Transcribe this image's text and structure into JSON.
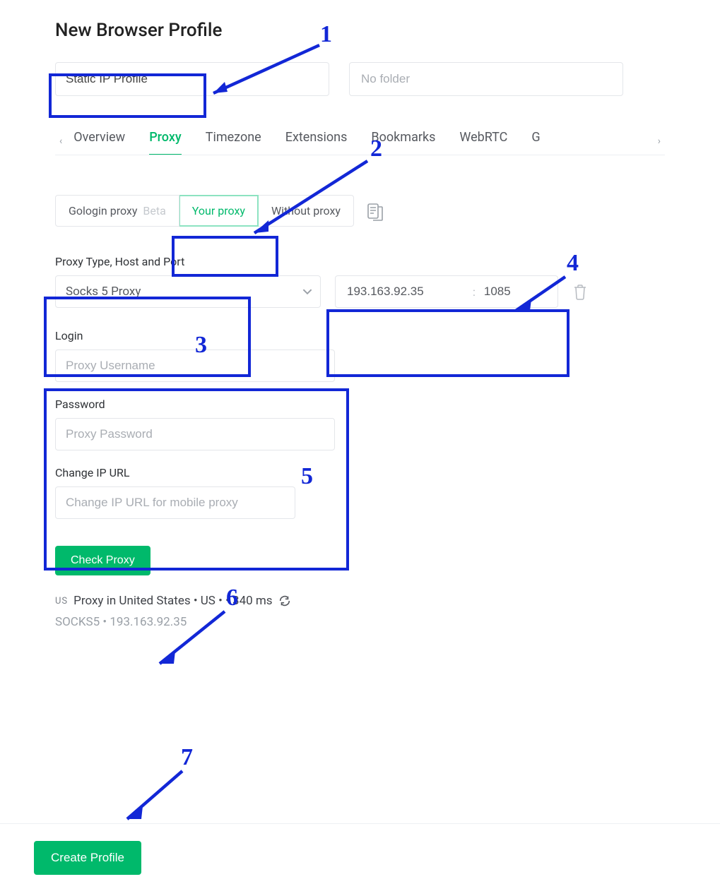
{
  "page": {
    "title": "New Browser Profile"
  },
  "profile": {
    "name": "Static IP Profile",
    "folder_placeholder": "No folder",
    "folder_value": ""
  },
  "tabs": {
    "items": [
      "Overview",
      "Proxy",
      "Timezone",
      "Extensions",
      "Bookmarks",
      "WebRTC",
      "G"
    ],
    "active_index": 1
  },
  "proxy_mode": {
    "options": [
      {
        "label": "Gologin proxy",
        "badge": "Beta"
      },
      {
        "label": "Your proxy"
      },
      {
        "label": "Without proxy"
      }
    ],
    "active_index": 1
  },
  "proxy": {
    "section_label": "Proxy Type, Host and Port",
    "type": "Socks 5 Proxy",
    "host": "193.163.92.35",
    "port": "1085",
    "login_label": "Login",
    "login_placeholder": "Proxy Username",
    "login_value": "",
    "password_label": "Password",
    "password_placeholder": "Proxy Password",
    "password_value": "",
    "change_ip_label": "Change IP URL",
    "change_ip_placeholder": "Change IP URL for mobile proxy",
    "change_ip_value": "",
    "check_btn": "Check Proxy"
  },
  "status": {
    "flag": "US",
    "line1": "Proxy in United States • US • • 340 ms",
    "line2": "SOCKS5 • 193.163.92.35"
  },
  "footer": {
    "create_btn": "Create Profile"
  },
  "annotations": {
    "n1": "1",
    "n2": "2",
    "n3": "3",
    "n4": "4",
    "n5": "5",
    "n6": "6",
    "n7": "7"
  }
}
